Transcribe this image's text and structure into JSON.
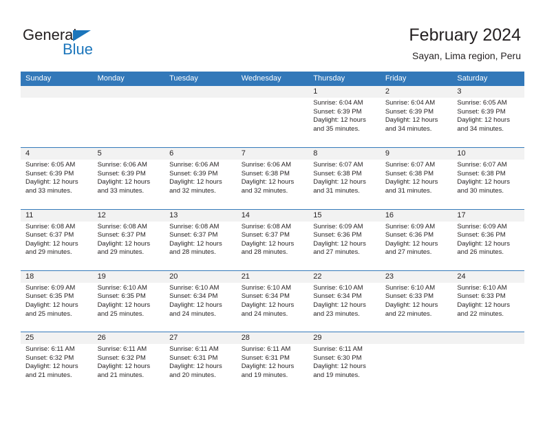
{
  "brand": {
    "name_part1": "General",
    "name_part2": "Blue"
  },
  "header": {
    "title": "February 2024",
    "subtitle": "Sayan, Lima region, Peru"
  },
  "colors": {
    "header_blue": "#3278b9",
    "brand_blue": "#1b75bb",
    "day_band": "#f2f2f2",
    "text": "#231f20"
  },
  "calendar": {
    "day_headers": [
      "Sunday",
      "Monday",
      "Tuesday",
      "Wednesday",
      "Thursday",
      "Friday",
      "Saturday"
    ],
    "weeks": [
      [
        {
          "day": "",
          "empty": true
        },
        {
          "day": "",
          "empty": true
        },
        {
          "day": "",
          "empty": true
        },
        {
          "day": "",
          "empty": true
        },
        {
          "day": "1",
          "sunrise": "Sunrise: 6:04 AM",
          "sunset": "Sunset: 6:39 PM",
          "daylight": "Daylight: 12 hours and 35 minutes."
        },
        {
          "day": "2",
          "sunrise": "Sunrise: 6:04 AM",
          "sunset": "Sunset: 6:39 PM",
          "daylight": "Daylight: 12 hours and 34 minutes."
        },
        {
          "day": "3",
          "sunrise": "Sunrise: 6:05 AM",
          "sunset": "Sunset: 6:39 PM",
          "daylight": "Daylight: 12 hours and 34 minutes."
        }
      ],
      [
        {
          "day": "4",
          "sunrise": "Sunrise: 6:05 AM",
          "sunset": "Sunset: 6:39 PM",
          "daylight": "Daylight: 12 hours and 33 minutes."
        },
        {
          "day": "5",
          "sunrise": "Sunrise: 6:06 AM",
          "sunset": "Sunset: 6:39 PM",
          "daylight": "Daylight: 12 hours and 33 minutes."
        },
        {
          "day": "6",
          "sunrise": "Sunrise: 6:06 AM",
          "sunset": "Sunset: 6:39 PM",
          "daylight": "Daylight: 12 hours and 32 minutes."
        },
        {
          "day": "7",
          "sunrise": "Sunrise: 6:06 AM",
          "sunset": "Sunset: 6:38 PM",
          "daylight": "Daylight: 12 hours and 32 minutes."
        },
        {
          "day": "8",
          "sunrise": "Sunrise: 6:07 AM",
          "sunset": "Sunset: 6:38 PM",
          "daylight": "Daylight: 12 hours and 31 minutes."
        },
        {
          "day": "9",
          "sunrise": "Sunrise: 6:07 AM",
          "sunset": "Sunset: 6:38 PM",
          "daylight": "Daylight: 12 hours and 31 minutes."
        },
        {
          "day": "10",
          "sunrise": "Sunrise: 6:07 AM",
          "sunset": "Sunset: 6:38 PM",
          "daylight": "Daylight: 12 hours and 30 minutes."
        }
      ],
      [
        {
          "day": "11",
          "sunrise": "Sunrise: 6:08 AM",
          "sunset": "Sunset: 6:37 PM",
          "daylight": "Daylight: 12 hours and 29 minutes."
        },
        {
          "day": "12",
          "sunrise": "Sunrise: 6:08 AM",
          "sunset": "Sunset: 6:37 PM",
          "daylight": "Daylight: 12 hours and 29 minutes."
        },
        {
          "day": "13",
          "sunrise": "Sunrise: 6:08 AM",
          "sunset": "Sunset: 6:37 PM",
          "daylight": "Daylight: 12 hours and 28 minutes."
        },
        {
          "day": "14",
          "sunrise": "Sunrise: 6:08 AM",
          "sunset": "Sunset: 6:37 PM",
          "daylight": "Daylight: 12 hours and 28 minutes."
        },
        {
          "day": "15",
          "sunrise": "Sunrise: 6:09 AM",
          "sunset": "Sunset: 6:36 PM",
          "daylight": "Daylight: 12 hours and 27 minutes."
        },
        {
          "day": "16",
          "sunrise": "Sunrise: 6:09 AM",
          "sunset": "Sunset: 6:36 PM",
          "daylight": "Daylight: 12 hours and 27 minutes."
        },
        {
          "day": "17",
          "sunrise": "Sunrise: 6:09 AM",
          "sunset": "Sunset: 6:36 PM",
          "daylight": "Daylight: 12 hours and 26 minutes."
        }
      ],
      [
        {
          "day": "18",
          "sunrise": "Sunrise: 6:09 AM",
          "sunset": "Sunset: 6:35 PM",
          "daylight": "Daylight: 12 hours and 25 minutes."
        },
        {
          "day": "19",
          "sunrise": "Sunrise: 6:10 AM",
          "sunset": "Sunset: 6:35 PM",
          "daylight": "Daylight: 12 hours and 25 minutes."
        },
        {
          "day": "20",
          "sunrise": "Sunrise: 6:10 AM",
          "sunset": "Sunset: 6:34 PM",
          "daylight": "Daylight: 12 hours and 24 minutes."
        },
        {
          "day": "21",
          "sunrise": "Sunrise: 6:10 AM",
          "sunset": "Sunset: 6:34 PM",
          "daylight": "Daylight: 12 hours and 24 minutes."
        },
        {
          "day": "22",
          "sunrise": "Sunrise: 6:10 AM",
          "sunset": "Sunset: 6:34 PM",
          "daylight": "Daylight: 12 hours and 23 minutes."
        },
        {
          "day": "23",
          "sunrise": "Sunrise: 6:10 AM",
          "sunset": "Sunset: 6:33 PM",
          "daylight": "Daylight: 12 hours and 22 minutes."
        },
        {
          "day": "24",
          "sunrise": "Sunrise: 6:10 AM",
          "sunset": "Sunset: 6:33 PM",
          "daylight": "Daylight: 12 hours and 22 minutes."
        }
      ],
      [
        {
          "day": "25",
          "sunrise": "Sunrise: 6:11 AM",
          "sunset": "Sunset: 6:32 PM",
          "daylight": "Daylight: 12 hours and 21 minutes."
        },
        {
          "day": "26",
          "sunrise": "Sunrise: 6:11 AM",
          "sunset": "Sunset: 6:32 PM",
          "daylight": "Daylight: 12 hours and 21 minutes."
        },
        {
          "day": "27",
          "sunrise": "Sunrise: 6:11 AM",
          "sunset": "Sunset: 6:31 PM",
          "daylight": "Daylight: 12 hours and 20 minutes."
        },
        {
          "day": "28",
          "sunrise": "Sunrise: 6:11 AM",
          "sunset": "Sunset: 6:31 PM",
          "daylight": "Daylight: 12 hours and 19 minutes."
        },
        {
          "day": "29",
          "sunrise": "Sunrise: 6:11 AM",
          "sunset": "Sunset: 6:30 PM",
          "daylight": "Daylight: 12 hours and 19 minutes."
        },
        {
          "day": "",
          "empty": true
        },
        {
          "day": "",
          "empty": true
        }
      ]
    ]
  }
}
